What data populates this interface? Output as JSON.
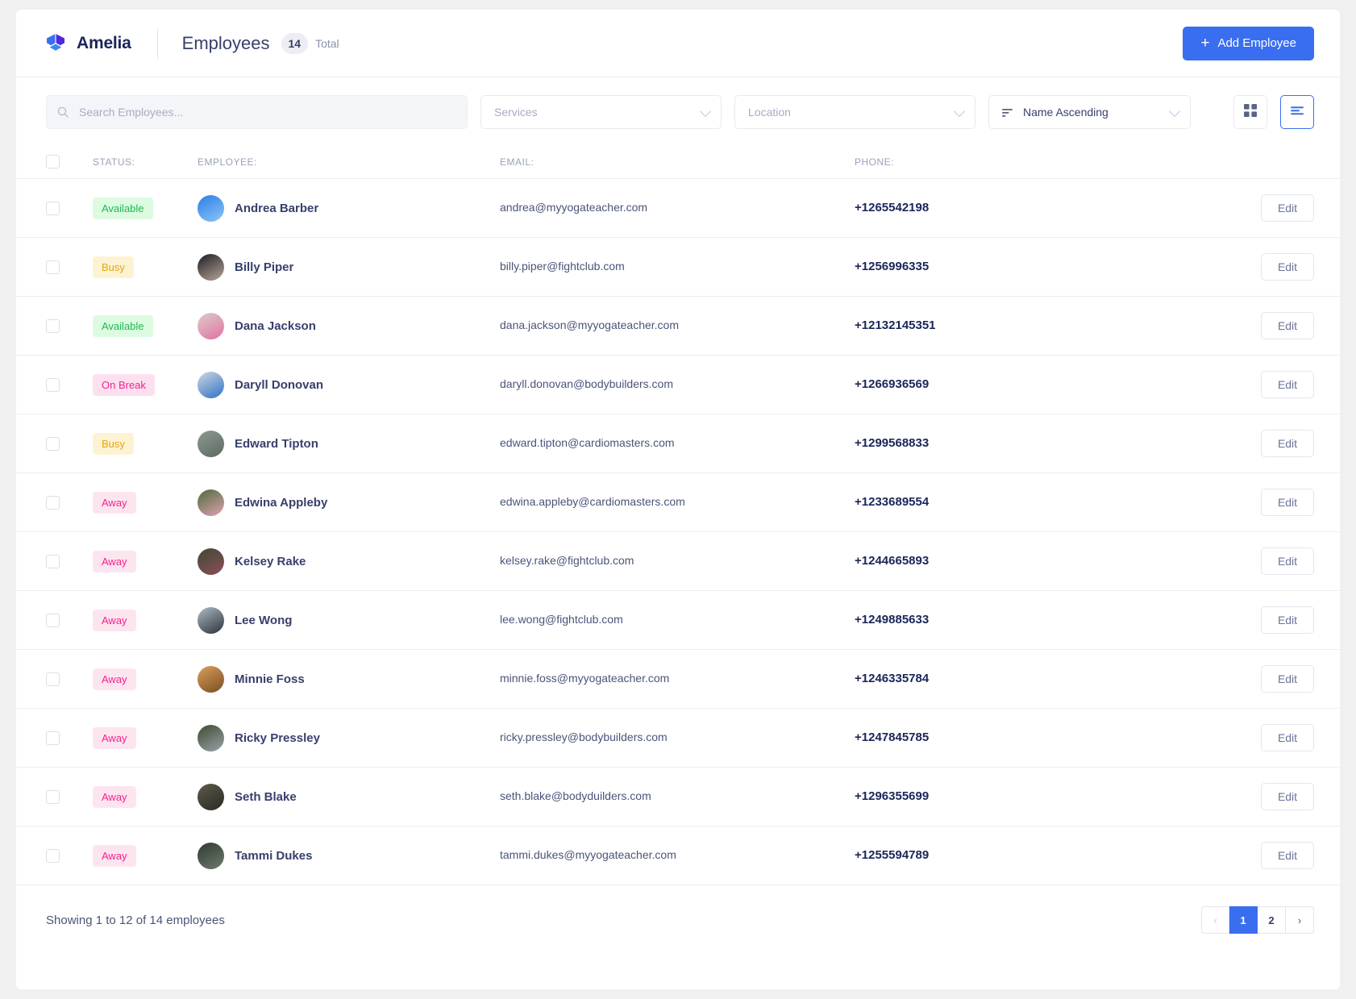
{
  "header": {
    "brand_name": "Amelia",
    "page_title": "Employees",
    "total_count": "14",
    "total_label": "Total",
    "add_button_label": "Add Employee",
    "add_button_icon": "plus-icon",
    "logo_icon": "amelia-cube-logo",
    "accent_color": "#3a6ef0"
  },
  "toolbar": {
    "search_placeholder": "Search Employees...",
    "search_value": "",
    "search_icon": "search-icon",
    "services_label": "Services",
    "location_label": "Location",
    "sort_label": "Name Ascending",
    "sort_icon": "sort-lines-icon",
    "grid_view_icon": "grid-view-icon",
    "list_view_icon": "list-view-icon",
    "active_view": "list"
  },
  "table": {
    "columns": [
      {
        "key": "status",
        "label": "STATUS:"
      },
      {
        "key": "employee",
        "label": "EMPLOYEE:"
      },
      {
        "key": "email",
        "label": "EMAIL:"
      },
      {
        "key": "phone",
        "label": "PHONE:"
      }
    ],
    "edit_label": "Edit",
    "rows": [
      {
        "status": "Available",
        "status_kind": "available",
        "name": "Andrea Barber",
        "email": "andrea@myyogateacher.com",
        "phone": "+1265542198",
        "avatar_from": "#2b7de9",
        "avatar_to": "#8ec5f5"
      },
      {
        "status": "Busy",
        "status_kind": "busy",
        "name": "Billy Piper",
        "email": "billy.piper@fightclub.com",
        "phone": "+1256996335",
        "avatar_from": "#1c1c22",
        "avatar_to": "#b9a79a"
      },
      {
        "status": "Available",
        "status_kind": "available",
        "name": "Dana Jackson",
        "email": "dana.jackson@myyogateacher.com",
        "phone": "+12132145351",
        "avatar_from": "#d9cfc7",
        "avatar_to": "#e56fa4"
      },
      {
        "status": "On Break",
        "status_kind": "onbreak",
        "name": "Daryll Donovan",
        "email": "daryll.donovan@bodybuilders.com",
        "phone": "+1266936569",
        "avatar_from": "#cfd7e0",
        "avatar_to": "#2f72c6"
      },
      {
        "status": "Busy",
        "status_kind": "busy",
        "name": "Edward Tipton",
        "email": "edward.tipton@cardiomasters.com",
        "phone": "+1299568833",
        "avatar_from": "#8c9a92",
        "avatar_to": "#5d6a62"
      },
      {
        "status": "Away",
        "status_kind": "away",
        "name": "Edwina Appleby",
        "email": "edwina.appleby@cardiomasters.com",
        "phone": "+1233689554",
        "avatar_from": "#4d6b3a",
        "avatar_to": "#e1a1b4"
      },
      {
        "status": "Away",
        "status_kind": "away",
        "name": "Kelsey Rake",
        "email": "kelsey.rake@fightclub.com",
        "phone": "+1244665893",
        "avatar_from": "#3c4a33",
        "avatar_to": "#8e4d58"
      },
      {
        "status": "Away",
        "status_kind": "away",
        "name": "Lee Wong",
        "email": "lee.wong@fightclub.com",
        "phone": "+1249885633",
        "avatar_from": "#aebcc6",
        "avatar_to": "#2d3138"
      },
      {
        "status": "Away",
        "status_kind": "away",
        "name": "Minnie Foss",
        "email": "minnie.foss@myyogateacher.com",
        "phone": "+1246335784",
        "avatar_from": "#d9a05b",
        "avatar_to": "#7a4c22"
      },
      {
        "status": "Away",
        "status_kind": "away",
        "name": "Ricky Pressley",
        "email": "ricky.pressley@bodybuilders.com",
        "phone": "+1247845785",
        "avatar_from": "#3e4a2e",
        "avatar_to": "#9aa3ab"
      },
      {
        "status": "Away",
        "status_kind": "away",
        "name": "Seth Blake",
        "email": "seth.blake@bodyduilders.com",
        "phone": "+1296355699",
        "avatar_from": "#5d5a4c",
        "avatar_to": "#2b2a24"
      },
      {
        "status": "Away",
        "status_kind": "away",
        "name": "Tammi Dukes",
        "email": "tammi.dukes@myyogateacher.com",
        "phone": "+1255594789",
        "avatar_from": "#2f3a33",
        "avatar_to": "#6d7a6a"
      }
    ]
  },
  "footer": {
    "showing_text": "Showing 1 to 12 of 14 employees",
    "pages": [
      {
        "label": "‹",
        "kind": "prev"
      },
      {
        "label": "1",
        "kind": "page",
        "current": true
      },
      {
        "label": "2",
        "kind": "page",
        "current": false
      },
      {
        "label": "›",
        "kind": "next"
      }
    ]
  }
}
